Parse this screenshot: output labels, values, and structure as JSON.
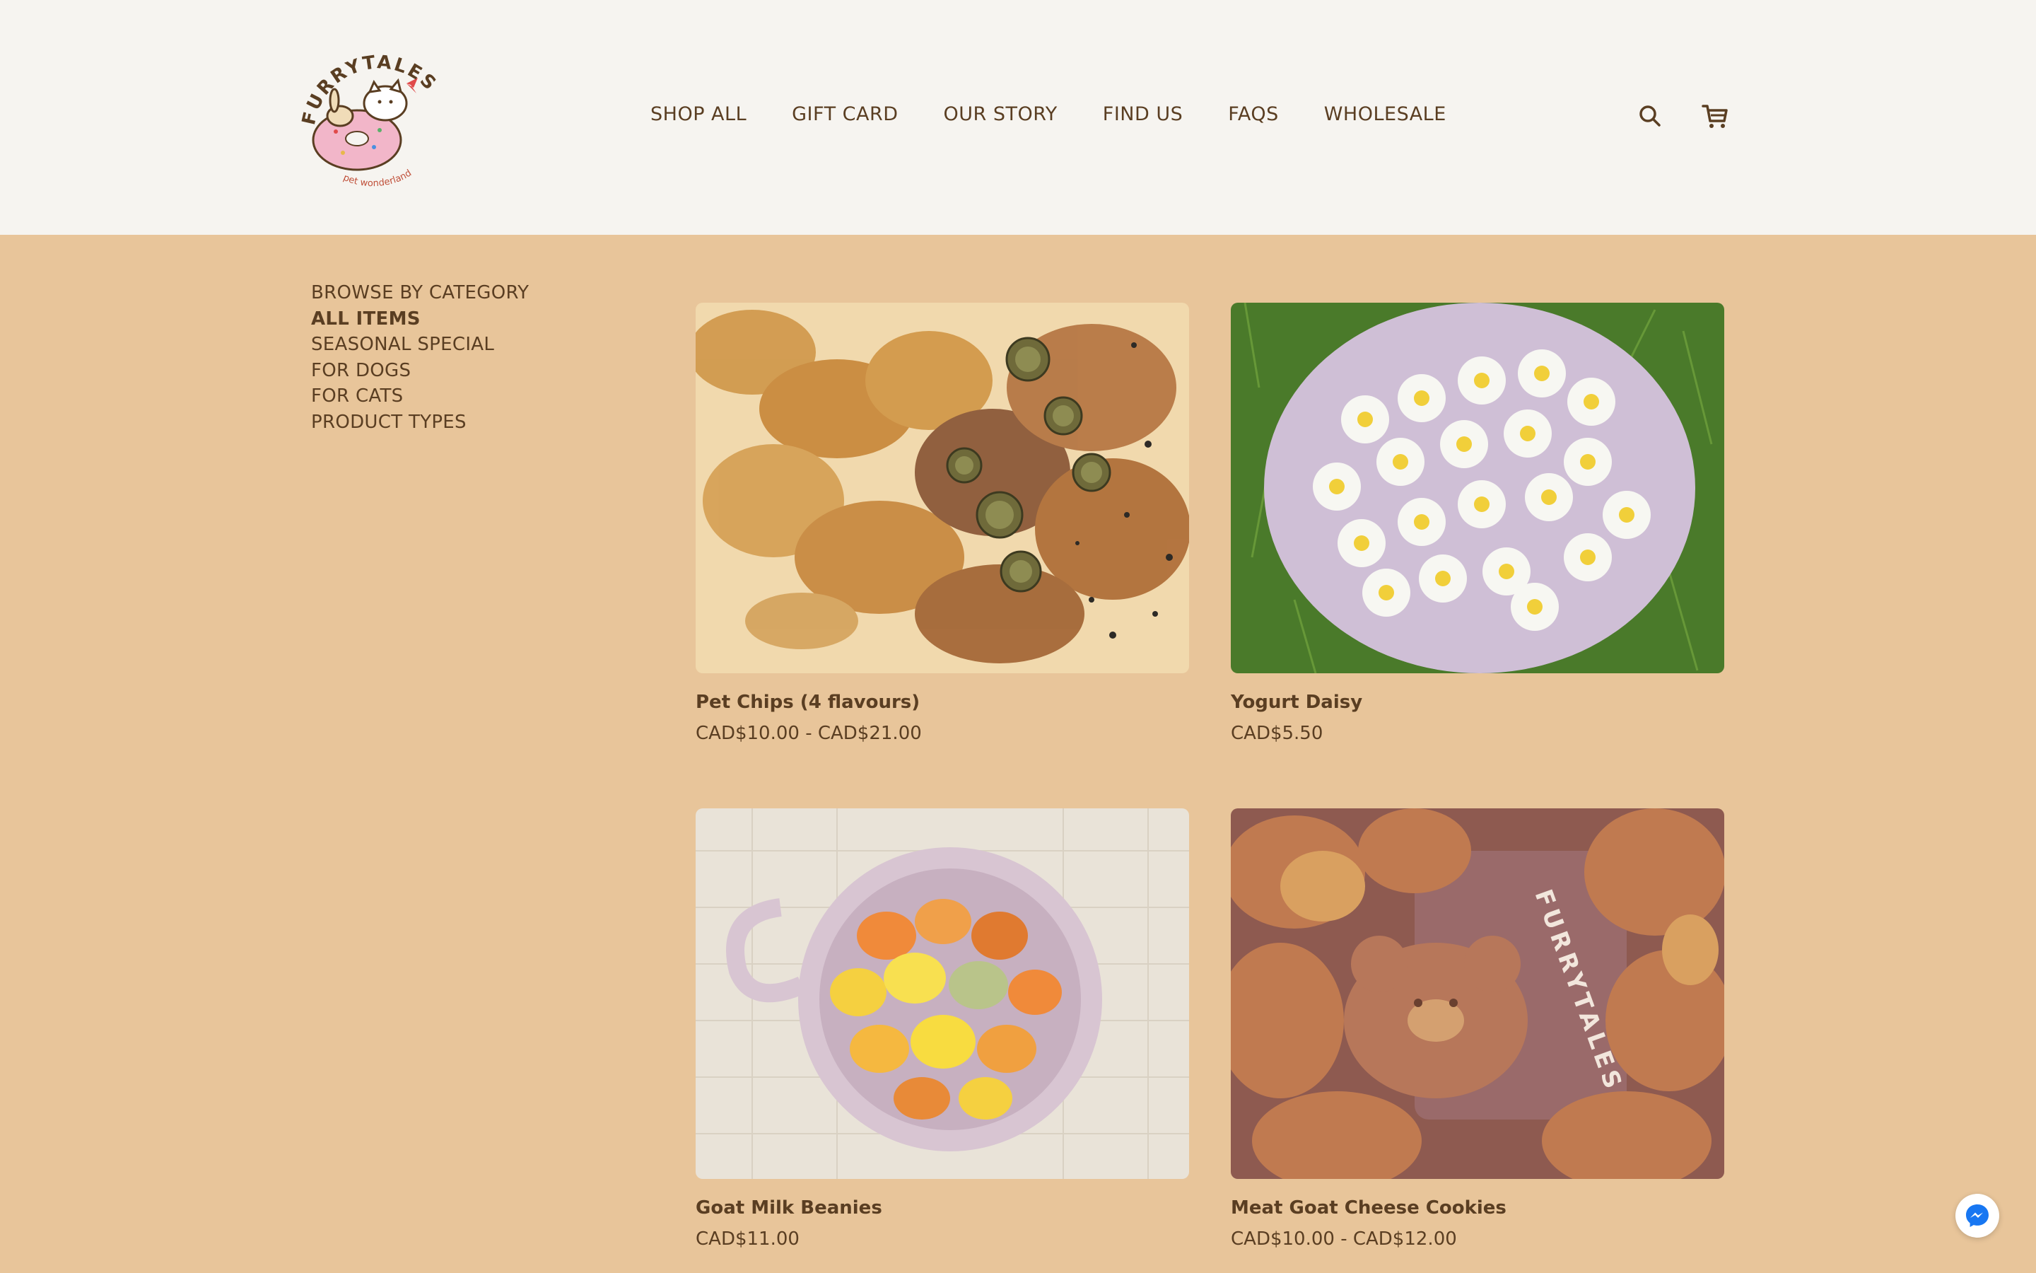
{
  "brand": {
    "logo_text": "FURRYTALES",
    "logo_tagline": "pet wonderland"
  },
  "nav": {
    "items": [
      "SHOP ALL",
      "GIFT CARD",
      "OUR STORY",
      "FIND US",
      "FAQS",
      "WHOLESALE"
    ]
  },
  "icons": {
    "search": "search-icon",
    "cart": "cart-icon",
    "messenger": "messenger-icon"
  },
  "sidebar": {
    "heading": "BROWSE BY CATEGORY",
    "items": [
      {
        "label": "ALL ITEMS",
        "active": true
      },
      {
        "label": "SEASONAL SPECIAL",
        "active": false
      },
      {
        "label": "FOR DOGS",
        "active": false
      },
      {
        "label": "FOR CATS",
        "active": false
      },
      {
        "label": "PRODUCT TYPES",
        "active": false
      }
    ]
  },
  "products": [
    {
      "title": "Pet Chips (4 flavours)",
      "price": "CAD$10.00 - CAD$21.00"
    },
    {
      "title": "Yogurt Daisy",
      "price": "CAD$5.50"
    },
    {
      "title": "Goat Milk Beanies",
      "price": "CAD$11.00"
    },
    {
      "title": "Meat Goat Cheese Cookies",
      "price": "CAD$10.00 - CAD$12.00"
    }
  ],
  "colors": {
    "header_bg": "#f6f4f0",
    "page_bg": "#e8c59a",
    "text": "#5a3e22",
    "messenger_blue": "#1877f2"
  }
}
